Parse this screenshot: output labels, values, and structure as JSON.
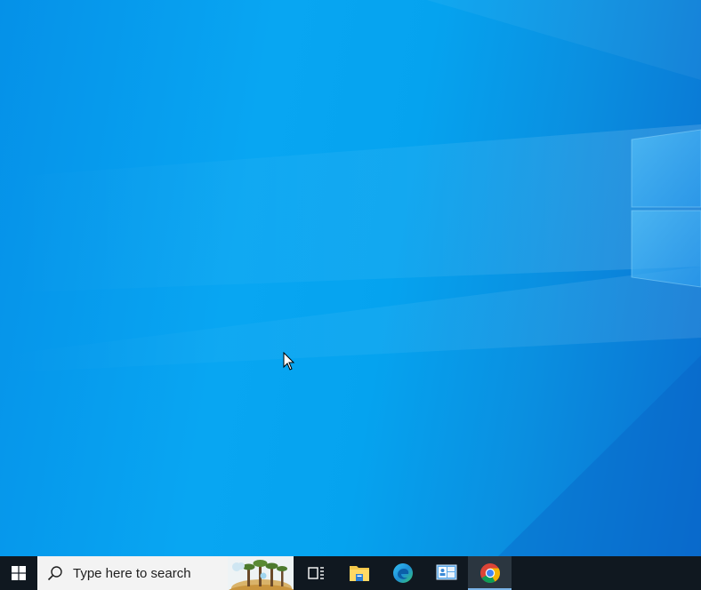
{
  "desktop": {
    "wallpaper": "windows-10-hero",
    "background_color": "#08a6f2",
    "logo_color": "#3ab0f4"
  },
  "taskbar": {
    "background_color": "#101820",
    "start_icon": "windows-logo-icon",
    "search": {
      "placeholder": "Type here to search",
      "icon": "search-icon",
      "highlight_icon": "search-highlight-image"
    },
    "pinned": [
      {
        "name": "task-view",
        "icon": "task-view-icon",
        "active": false
      },
      {
        "name": "file-explorer",
        "icon": "file-explorer-icon",
        "active": false
      },
      {
        "name": "edge",
        "icon": "edge-icon",
        "active": false
      },
      {
        "name": "control-panel",
        "icon": "control-panel-icon",
        "active": false
      },
      {
        "name": "chrome",
        "icon": "chrome-icon",
        "active": true
      }
    ]
  }
}
